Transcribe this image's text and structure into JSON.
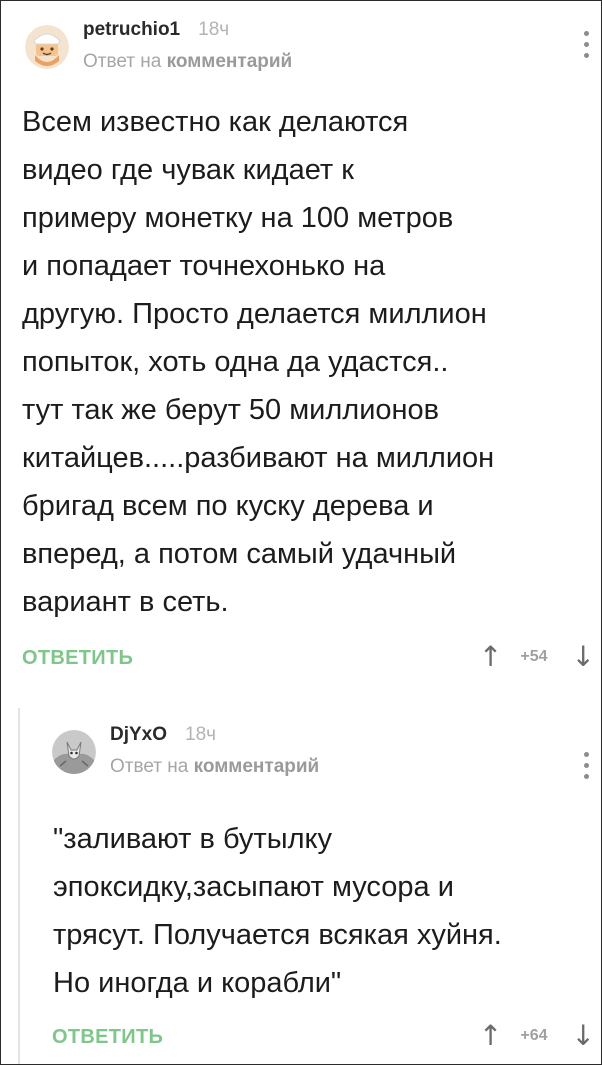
{
  "comments": [
    {
      "username": "petruchio1",
      "time": "18ч",
      "reply_prefix": "Ответ на ",
      "reply_target": "комментарий",
      "text": "Всем известно как делаются\nвидео где чувак кидает к\nпримеру монетку на 100 метров\nи попадает точнехонько на\nдругую. Просто делается миллион\nпопыток, хоть одна да удастся..\nтут так же берут 50 миллионов\nкитайцев.....разбивают на миллион\nбригад всем по куску дерева и\nвперед, а потом самый удачный\nвариант в сеть.",
      "reply_label": "ОТВЕТИТЬ",
      "rating": "+54"
    },
    {
      "username": "DjYxO",
      "time": "18ч",
      "reply_prefix": "Ответ на ",
      "reply_target": "комментарий",
      "text": "\"заливают в бутылку\nэпоксидку,засыпают мусора и\nтрясут. Получается всякая хуйня.\nНо иногда и корабли\"",
      "reply_label": "ОТВЕТИТЬ",
      "rating": "+64"
    }
  ],
  "icons": {
    "upvote": "↑",
    "downvote": "↓",
    "more": "more-vertical-icon"
  },
  "colors": {
    "reply_green": "#7fc68a",
    "meta_gray": "#a6a6a6"
  }
}
